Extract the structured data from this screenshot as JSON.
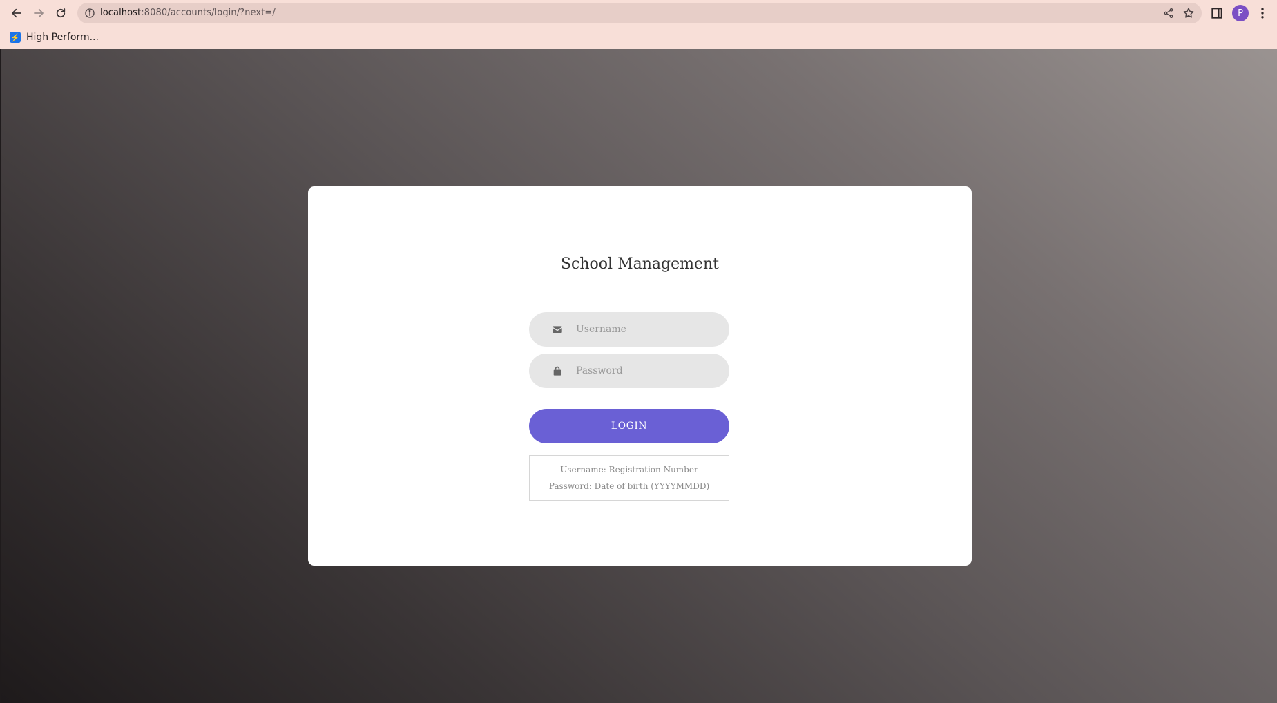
{
  "browser": {
    "url_host": "localhost",
    "url_rest": ":8080/accounts/login/?next=/",
    "profile_initial": "P",
    "bookmarks": [
      {
        "label": "High Perform..."
      }
    ]
  },
  "login": {
    "title": "School Management",
    "username_placeholder": "Username",
    "password_placeholder": "Password",
    "login_label": "LOGIN",
    "hint_username": "Username: Registration Number",
    "hint_password": "Password: Date of birth (YYYYMMDD)"
  },
  "colors": {
    "accent": "#6a60d5",
    "field_bg": "#e6e6e6",
    "chrome_bg": "#f8dfd8"
  }
}
